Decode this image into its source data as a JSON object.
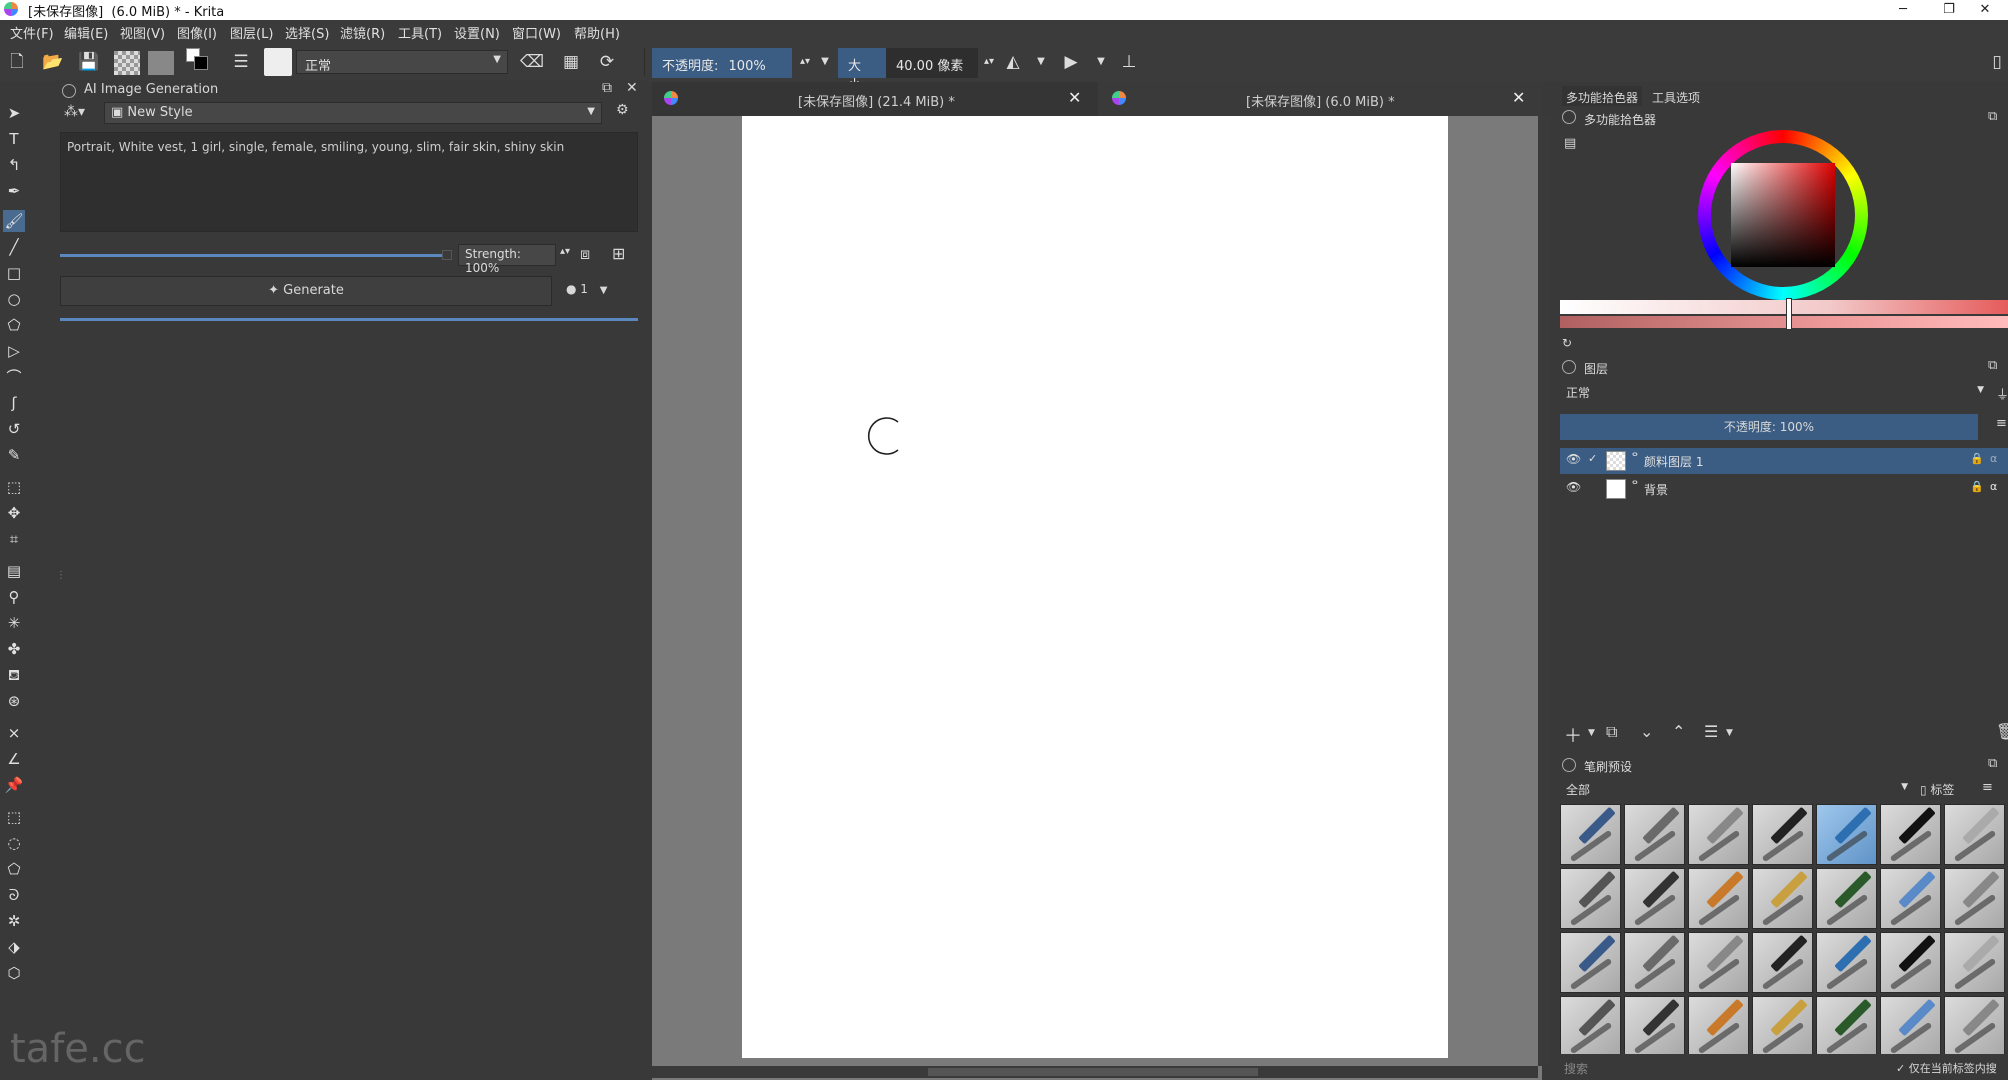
{
  "window": {
    "title": "[未保存图像]  (6.0 MiB) * - Krita"
  },
  "menu": [
    "文件(F)",
    "编辑(E)",
    "视图(V)",
    "图像(I)",
    "图层(L)",
    "选择(S)",
    "滤镜(R)",
    "工具(T)",
    "设置(N)",
    "窗口(W)",
    "帮助(H)"
  ],
  "toolbar": {
    "blend_mode": "正常",
    "opacity_label": "不透明度:",
    "opacity_value": "100%",
    "size_label": "大小:",
    "size_value": "40.00 像素"
  },
  "ai_docker": {
    "title": "AI Image Generation",
    "style_name": "New Style",
    "prompt": "Portrait, White vest, 1 girl, single, female, smiling, young, slim, fair skin, shiny skin",
    "strength_label": "Strength: 100%",
    "strength": 1.0,
    "generate_label": "Generate",
    "batch_count": "1"
  },
  "tabs": [
    {
      "label": "[未保存图像]  (21.4 MiB) *"
    },
    {
      "label": "[未保存图像]  (6.0 MiB) *"
    }
  ],
  "right_panel": {
    "top_tabs": [
      "多功能拾色器",
      "工具选项"
    ],
    "color_selector_title": "多功能拾色器",
    "layers_title": "图层",
    "layer_blend": "正常",
    "layer_opacity": "不透明度: 100%",
    "layers": [
      {
        "name": "颜料图层 1",
        "selected": true
      },
      {
        "name": "背景",
        "selected": false
      }
    ],
    "brush_presets_title": "笔刷预设",
    "brush_filter": "全部",
    "tag_label": "标签",
    "search_placeholder": "搜索",
    "search_checkbox_label": "仅在当前标签内搜"
  },
  "watermark": "tafe.cc",
  "colors": {
    "accent": "#3b5d84",
    "panel": "#393939",
    "canvas_bg": "#7a7a7a",
    "paper": "#ffffff"
  }
}
